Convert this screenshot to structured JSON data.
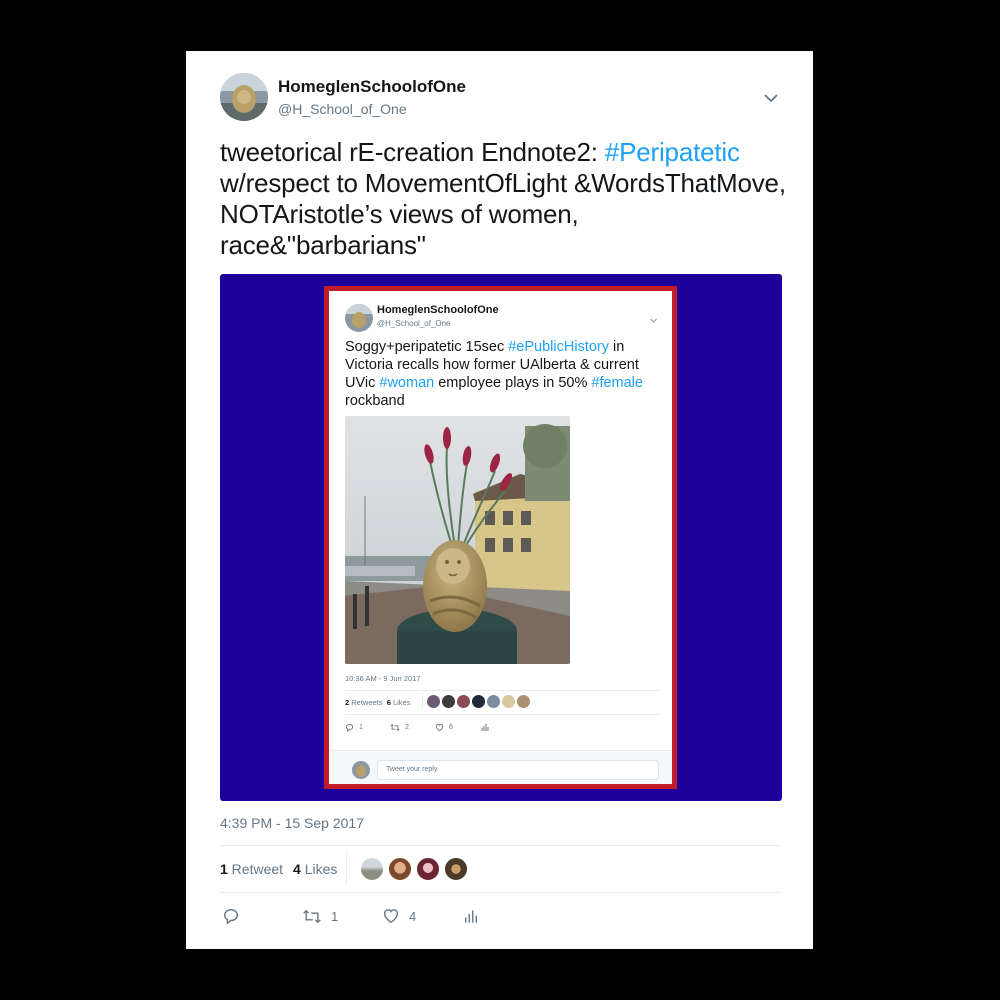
{
  "tweet": {
    "display_name": "HomeglenSchoolofOne",
    "handle": "@H_School_of_One",
    "text_part1": "tweetorical rE-creation Endnote2: ",
    "hashtag": "#Peripatetic",
    "text_part2": " w/respect to MovementOfLight &WordsThatMove, NOTAristotle’s views of women, race&\"barbarians\"",
    "timestamp": "4:39 PM - 15 Sep 2017",
    "retweets_count": "1",
    "retweets_label": " Retweet",
    "likes_count": "4",
    "likes_label": " Likes",
    "action_retweet_count": "1",
    "action_like_count": "4"
  },
  "embedded_tweet": {
    "display_name": "HomeglenSchoolofOne",
    "handle": "@H_School_of_One",
    "text_a": "Soggy+peripatetic 15sec ",
    "tag_a": "#ePublicHistory",
    "text_b": " in Victoria recalls how former UAlberta & current UVic ",
    "tag_b": "#woman",
    "text_c": " employee plays in 50% ",
    "tag_c": "#female",
    "text_d": " rockband",
    "timestamp": "10:36 AM - 9 Jun 2017",
    "retweets_count": "2",
    "retweets_label": " Retweets",
    "likes_count": "6",
    "likes_label": " Likes",
    "action_reply_count": "1",
    "action_retweet_count": "2",
    "action_like_count": "6",
    "reply_placeholder": "Tweet your reply"
  },
  "colors": {
    "accent": "#1da1f2",
    "media_background": "#1d009a",
    "frame": "#c21c2a"
  },
  "icons": [
    "avatar-stone-face",
    "chevron-down-icon",
    "reply-icon",
    "retweet-icon",
    "heart-icon",
    "analytics-icon"
  ]
}
